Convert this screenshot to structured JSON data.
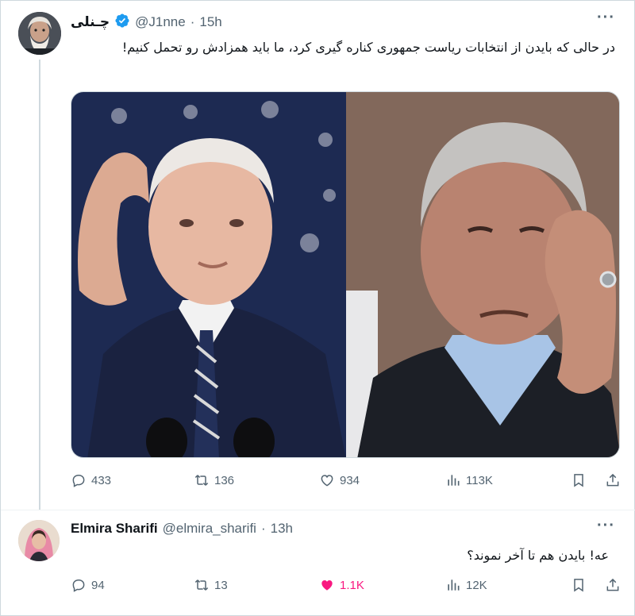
{
  "tweet1": {
    "display_name": "چـنلی",
    "handle": "@J1nne",
    "separator": "·",
    "time": "15h",
    "more_label": "···",
    "text": "در حالی که بایدن از انتخابات ریاست جمهوری کناره گیری کرد، ما باید همزادش رو تحمل کنیم!",
    "metrics": {
      "replies": "433",
      "reposts": "136",
      "likes": "934",
      "views": "113K"
    }
  },
  "tweet2": {
    "display_name": "Elmira Sharifi",
    "handle": "@elmira_sharifi",
    "separator": "·",
    "time": "13h",
    "more_label": "···",
    "text": "عه! بایدن هم تا آخر نموند؟",
    "liked": true,
    "metrics": {
      "replies": "94",
      "reposts": "13",
      "likes": "1.1K",
      "views": "12K"
    }
  },
  "colors": {
    "text_primary": "#0f1419",
    "text_secondary": "#536471",
    "verified_blue": "#1d9bf0",
    "like_pink": "#f91880",
    "border": "#cfd9de"
  },
  "icons": {
    "verified": "verified-badge-icon",
    "reply": "speech-bubble-icon",
    "repost": "repost-arrows-icon",
    "like": "heart-icon",
    "views": "bar-chart-icon",
    "bookmark": "bookmark-icon",
    "share": "share-upload-icon",
    "more": "more-dots-icon"
  }
}
